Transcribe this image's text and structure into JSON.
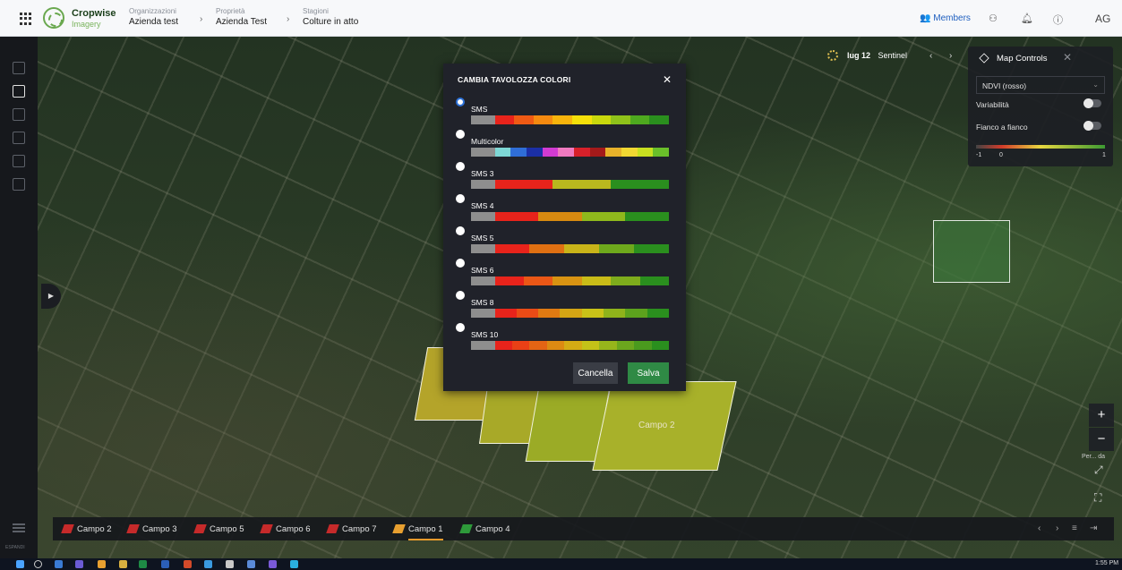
{
  "header": {
    "brand_name": "Cropwise",
    "brand_sub": "Imagery",
    "breadcrumbs": [
      {
        "label": "Organizzazioni",
        "value": "Azienda test"
      },
      {
        "label": "Proprietà",
        "value": "Azienda Test"
      },
      {
        "label": "Stagioni",
        "value": "Colture in atto"
      }
    ],
    "members_label": "Members",
    "avatar_initials": "AG"
  },
  "left_rail": {
    "expand_label": "ESPANDI"
  },
  "date_control": {
    "date": "lug 12",
    "source": "Sentinel"
  },
  "map_controls": {
    "title": "Map Controls",
    "layer_select": "NDVI (rosso)",
    "toggles": [
      {
        "label": "Variabilità",
        "on": false
      },
      {
        "label": "Fianco a fianco",
        "on": false
      }
    ],
    "scale_labels": [
      "-1",
      "0",
      "1"
    ]
  },
  "map": {
    "field_label": "Campo 2",
    "side_label": "Per... da"
  },
  "modal": {
    "title": "CAMBIA TAVOLOZZA COLORI",
    "cancel_label": "Cancella",
    "save_label": "Salva",
    "selected": "SMS",
    "palettes": [
      {
        "name": "SMS",
        "colors": [
          "#8e8e8e",
          "#e8231b",
          "#ef5a14",
          "#f58a10",
          "#f8b40c",
          "#f5e00a",
          "#c9d80d",
          "#8fc21a",
          "#4ea91f",
          "#2a8f1e"
        ]
      },
      {
        "name": "Multicolor",
        "colors": [
          "#8e8e8e",
          "#7ed8d6",
          "#2f6ed8",
          "#1b2fa6",
          "#d23bd2",
          "#f07ac0",
          "#d8202a",
          "#a41a1a",
          "#e8b22a",
          "#f2d832",
          "#c8e020",
          "#6abf2a"
        ]
      },
      {
        "name": "SMS 3",
        "colors": [
          "#8e8e8e",
          "#e8231b",
          "#b9b81e",
          "#2a8f1e"
        ]
      },
      {
        "name": "SMS 4",
        "colors": [
          "#8e8e8e",
          "#e8231b",
          "#d88a10",
          "#8fb81c",
          "#2a8f1e"
        ]
      },
      {
        "name": "SMS 5",
        "colors": [
          "#8e8e8e",
          "#e8231b",
          "#e07012",
          "#c9b419",
          "#6ea91c",
          "#2a8f1e"
        ]
      },
      {
        "name": "SMS 6",
        "colors": [
          "#8e8e8e",
          "#e8231b",
          "#ea5716",
          "#d89312",
          "#c9bc18",
          "#7eac1c",
          "#2a8f1e"
        ]
      },
      {
        "name": "SMS 8",
        "colors": [
          "#8e8e8e",
          "#e8231b",
          "#ea4b16",
          "#e07a12",
          "#d4a514",
          "#c9c218",
          "#8fb31b",
          "#5ca21d",
          "#2a8f1e"
        ]
      },
      {
        "name": "SMS 10",
        "colors": [
          "#8e8e8e",
          "#e8231b",
          "#ea4016",
          "#e46414",
          "#dc8a12",
          "#d4ab14",
          "#c4c218",
          "#97b51b",
          "#6ba61d",
          "#4a9a1e",
          "#2a8f1e"
        ]
      }
    ]
  },
  "fields_bar": {
    "tabs": [
      {
        "label": "Campo 2",
        "color": "#c62a2a",
        "active": false
      },
      {
        "label": "Campo 3",
        "color": "#c62a2a",
        "active": false
      },
      {
        "label": "Campo 5",
        "color": "#c62a2a",
        "active": false
      },
      {
        "label": "Campo 6",
        "color": "#c62a2a",
        "active": false
      },
      {
        "label": "Campo 7",
        "color": "#c62a2a",
        "active": false
      },
      {
        "label": "Campo 1",
        "color": "#e8a030",
        "active": true
      },
      {
        "label": "Campo 4",
        "color": "#2e9a3a",
        "active": false
      }
    ]
  },
  "taskbar": {
    "time": "1:55 PM"
  }
}
